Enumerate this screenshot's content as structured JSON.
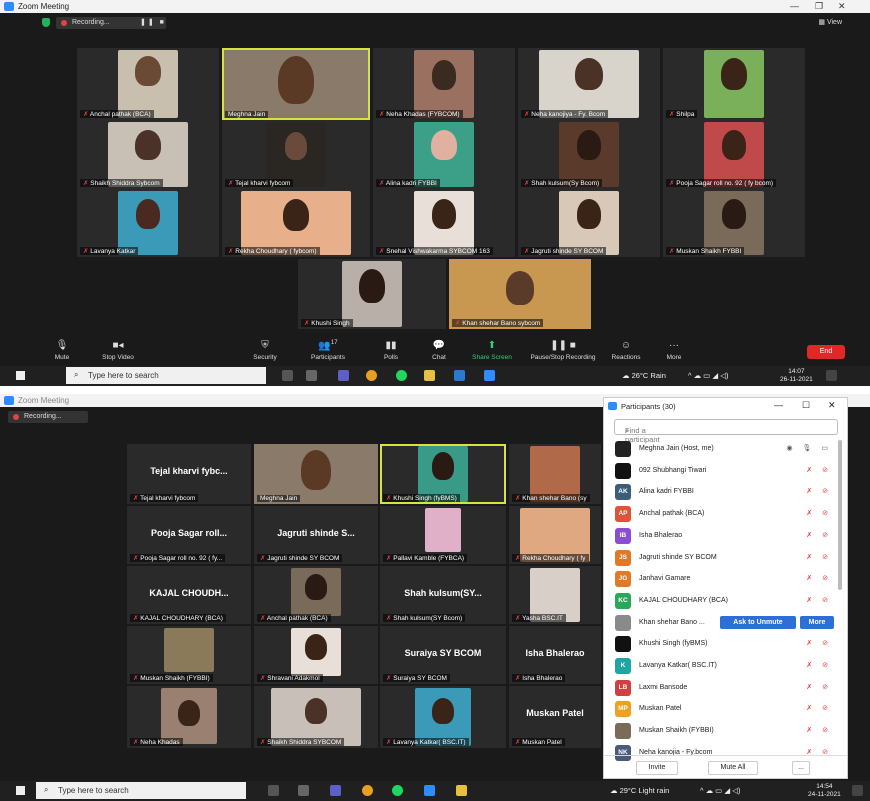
{
  "window1": {
    "title": "Zoom Meeting",
    "recording_label": "Recording...",
    "view_label": "View",
    "tiles_row1": [
      "Anchal pathak (BCA)",
      "Meghna Jain",
      "Neha Khadas (FYBCOM)",
      "Neha kanojiya - Fy. Bcom",
      "Shilpa"
    ],
    "tiles_row2": [
      "Shaikh Shiddra Sybcom",
      "Tejal kharvi fybcom",
      "Alina kadri FYBBI",
      "Shah kulsum(Sy Bcom)",
      "Pooja Sagar roll no. 92 ( fy bcom)"
    ],
    "tiles_row3": [
      "Lavanya Katkar",
      "Rekha Choudhary ( fybcom)",
      "Snehal Vishwakarma SYBCOM 163",
      "Jagruti shinde SY BCOM",
      "Muskan Shaikh FYBBI"
    ],
    "tiles_row4": [
      "Khushi Singh",
      "Khan shehar Bano sybcom"
    ],
    "toolbar": {
      "mute": "Mute",
      "stop_video": "Stop Video",
      "security": "Security",
      "participants": "Participants",
      "participants_count": "17",
      "polls": "Polls",
      "chat": "Chat",
      "share_screen": "Share Screen",
      "pause_recording": "Pause/Stop Recording",
      "reactions": "Reactions",
      "more": "More",
      "end": "End"
    },
    "taskbar": {
      "search": "Type here to search",
      "weather": "26°C Rain",
      "time": "14:07",
      "date": "26-11-2021"
    }
  },
  "window2": {
    "title": "Zoom Meeting",
    "recording_label": "Recording...",
    "bignames": {
      "tejal": "Tejal kharvi fybc...",
      "pooja": "Pooja Sagar roll...",
      "jagruti": "Jagruti shinde S...",
      "kajal": "KAJAL CHOUDH...",
      "shah": "Shah kulsum(SY...",
      "suraiya": "Suraiya SY BCOM",
      "isha": "Isha Bhalerao",
      "muskan_patel": "Muskan Patel"
    },
    "tiles": [
      "Tejal kharvi fybcom",
      "Meghna Jain",
      "Khushi Singh (fyBMS)",
      "Khan shehar Bano (sy",
      "Pooja Sagar roll no. 92 ( fy...",
      "Jagruti shinde SY BCOM",
      "Pallavi Kamble (FYBCA)",
      "Rekha Choudhary ( fy",
      "KAJAL CHOUDHARY (BCA)",
      "Anchal pathak (BCA)",
      "Shah kulsum(SY Bcom)",
      "Yasha BSC.IT",
      "Muskan Shaikh (FYBBI)",
      "Shravani Adakmol",
      "Suraiya SY BCOM",
      "Isha Bhalerao",
      "Neha Khadas",
      "Shaikh Shiddra SYBCOM",
      "Lavanya Katkar( BSC.IT)",
      "Muskan Patel"
    ],
    "taskbar": {
      "search": "Type here to search",
      "weather": "29°C Light rain",
      "time": "14:54",
      "date": "24-11-2021"
    }
  },
  "participants_panel": {
    "title": "Participants (30)",
    "find_placeholder": "Find a participant",
    "ask_to_unmute": "Ask to Unmute",
    "more": "More",
    "invite": "Invite",
    "mute_all": "Mute All",
    "ellipsis": "...",
    "rows": [
      {
        "initials": "",
        "name": "Meghna Jain (Host, me)",
        "color": "#222222"
      },
      {
        "initials": "",
        "name": "092 Shubhangi Tiwari",
        "color": "#111111"
      },
      {
        "initials": "AK",
        "name": "Alina kadri  FYBBI",
        "color": "#3b5f7a"
      },
      {
        "initials": "AP",
        "name": "Anchal pathak  (BCA)",
        "color": "#e0533b"
      },
      {
        "initials": "IB",
        "name": "Isha Bhalerao",
        "color": "#8a4fd0"
      },
      {
        "initials": "JS",
        "name": "Jagruti shinde SY BCOM",
        "color": "#e07a28"
      },
      {
        "initials": "JG",
        "name": "Janhavi Gamare",
        "color": "#e07a28"
      },
      {
        "initials": "KC",
        "name": "KAJAL CHOUDHARY (BCA)",
        "color": "#2aa85a"
      },
      {
        "initials": "",
        "name": "Khan shehar Bano ...",
        "color": "#8a8a8a"
      },
      {
        "initials": "",
        "name": "Khushi Singh (fyBMS)",
        "color": "#111111"
      },
      {
        "initials": "K",
        "name": "Lavanya Katkar( BSC.IT)",
        "color": "#20a5a5"
      },
      {
        "initials": "LB",
        "name": "Laxmi Bansode",
        "color": "#d04040"
      },
      {
        "initials": "MP",
        "name": "Muskan Patel",
        "color": "#f0a020"
      },
      {
        "initials": "",
        "name": "Muskan Shaikh (FYBBI)",
        "color": "#7a6a5a"
      },
      {
        "initials": "NK",
        "name": "Neha kanojia - Fy.bcom",
        "color": "#4a5a7a"
      }
    ]
  }
}
